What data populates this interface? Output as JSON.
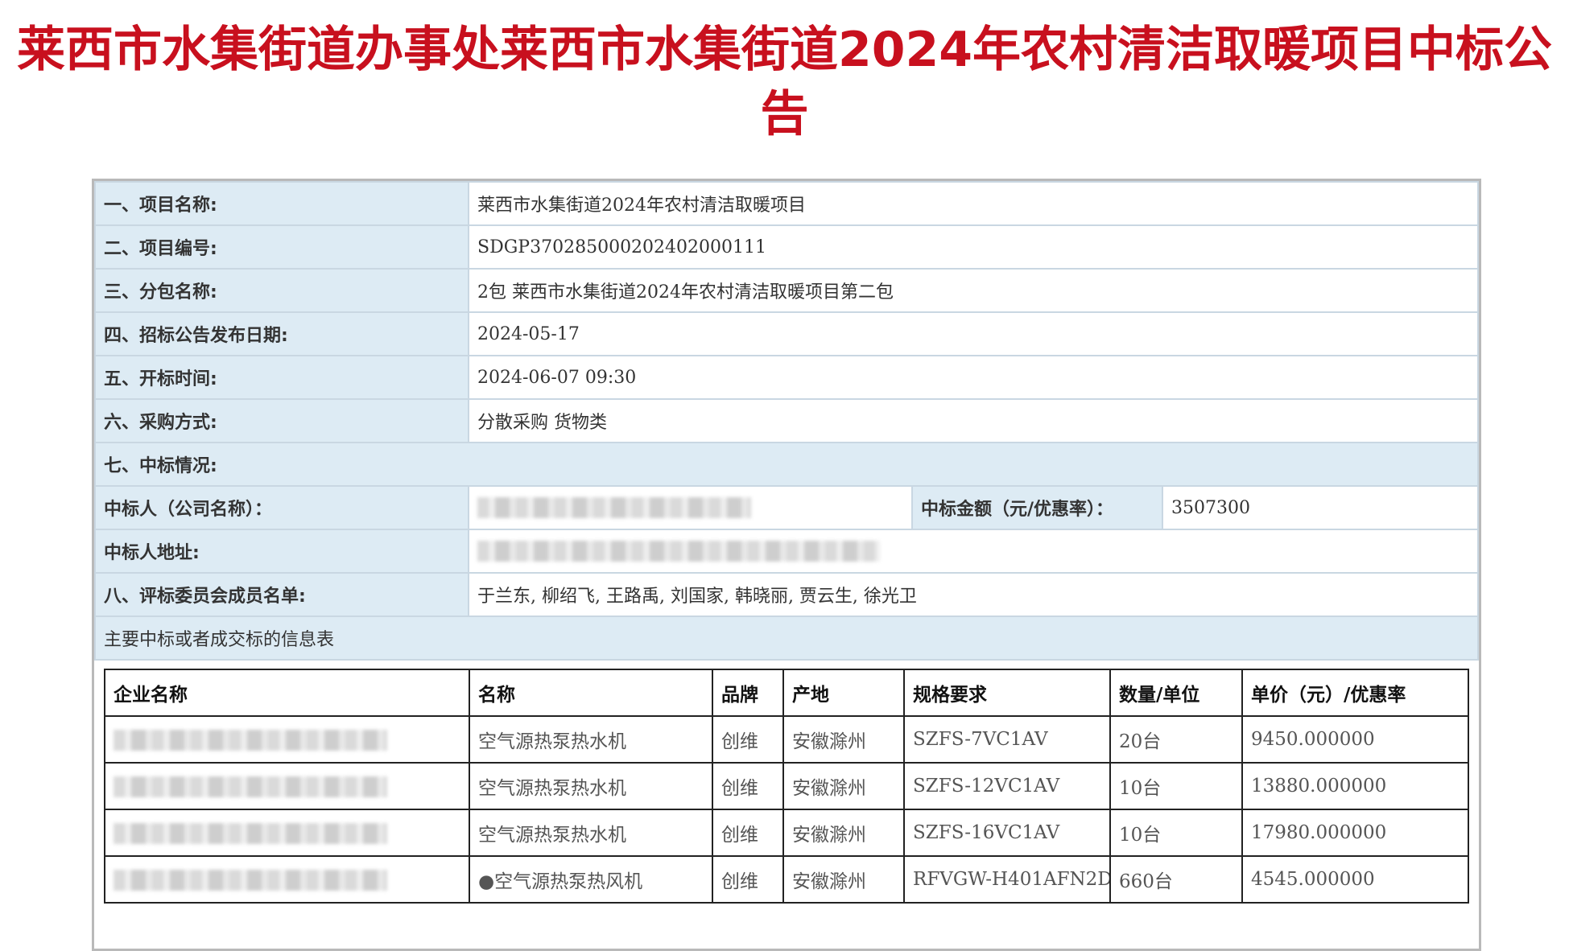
{
  "title": "莱西市水集街道办事处莱西市水集街道2024年农村清洁取暖项目中标公告",
  "info": {
    "project_name_label": "一、项目名称:",
    "project_name": "莱西市水集街道2024年农村清洁取暖项目",
    "project_no_label": "二、项目编号:",
    "project_no": "SDGP370285000202402000111",
    "package_label": "三、分包名称:",
    "package": "2包  莱西市水集街道2024年农村清洁取暖项目第二包",
    "publish_date_label": "四、招标公告发布日期:",
    "publish_date": "2024-05-17",
    "open_time_label": "五、开标时间:",
    "open_time": "2024-06-07 09:30",
    "method_label": "六、采购方式:",
    "method": "分散采购 货物类",
    "award_label": "七、中标情况:",
    "winner_label": "中标人（公司名称）：",
    "amount_label": "中标金额（元/优惠率）：",
    "amount": "3507300",
    "winner_addr_label": "中标人地址:",
    "committee_label": "八、评标委员会成员名单:",
    "committee": "于兰东, 柳绍飞, 王路禹, 刘国家, 韩晓丽, 贾云生, 徐光卫",
    "items_table_title": "主要中标或者成交标的信息表"
  },
  "items": {
    "headers": [
      "企业名称",
      "名称",
      "品牌",
      "产地",
      "规格要求",
      "数量/单位",
      "单价（元）/优惠率"
    ],
    "rows": [
      {
        "name": "空气源热泵热水机",
        "brand": "创维",
        "origin": "安徽滁州",
        "spec": "SZFS-7VC1AV",
        "qty": "20台",
        "price": "9450.000000"
      },
      {
        "name": "空气源热泵热水机",
        "brand": "创维",
        "origin": "安徽滁州",
        "spec": "SZFS-12VC1AV",
        "qty": "10台",
        "price": "13880.000000"
      },
      {
        "name": "空气源热泵热水机",
        "brand": "创维",
        "origin": "安徽滁州",
        "spec": "SZFS-16VC1AV",
        "qty": "10台",
        "price": "17980.000000"
      },
      {
        "name": "●空气源热泵热风机",
        "brand": "创维",
        "origin": "安徽滁州",
        "spec": "RFVGW-H401AFN2D",
        "qty": "660台",
        "price": "4545.000000"
      }
    ]
  }
}
